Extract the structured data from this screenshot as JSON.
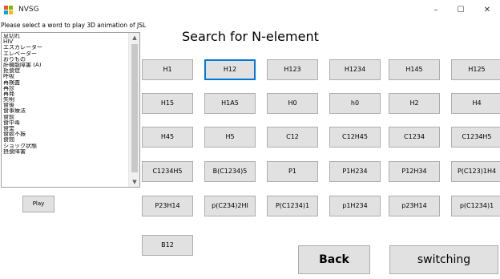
{
  "window": {
    "title": "NVSG",
    "minimize_label": "–",
    "maximize_label": "☐",
    "close_label": "✕"
  },
  "prompt": "Please select a word to play 3D animation of JSL",
  "word_list": [
    "息切れ",
    "HIV",
    "エスカレーター",
    "エレベーター",
    "おりもの",
    "肝機能障害 (A)",
    "拒食症",
    "呼吸",
    "再検査",
    "再診",
    "再発",
    "失明",
    "食後",
    "食事療法",
    "食前",
    "食中毒",
    "食堂",
    "食欲不振",
    "食間",
    "ショック状態",
    "摂食障害"
  ],
  "scroll": {
    "up_label": "▲",
    "down_label": "▼"
  },
  "play_label": "Play",
  "heading": "Search for N-element",
  "elements": [
    [
      "H1",
      "H12",
      "H123",
      "H1234",
      "H145",
      "H125"
    ],
    [
      "H15",
      "H1A5",
      "H0",
      "h0",
      "H2",
      "H4"
    ],
    [
      "H45",
      "H5",
      "C12",
      "C12H45",
      "C1234",
      "C1234H5"
    ],
    [
      "C1234H5",
      "B(C1234)5",
      "P1",
      "P1H234",
      "P12H34",
      "P(C123)1H4"
    ],
    [
      "P23H14",
      "p(C234)2HI",
      "P(C1234)1",
      "p1H234",
      "p23H14",
      "p(C1234)1"
    ],
    [
      "B12"
    ]
  ],
  "selected_element": "H12",
  "back_label": "Back",
  "switching_label": "switching",
  "colors": {
    "button_face": "#e1e1e1",
    "button_border": "#adadad",
    "focus_border": "#0078d7"
  }
}
